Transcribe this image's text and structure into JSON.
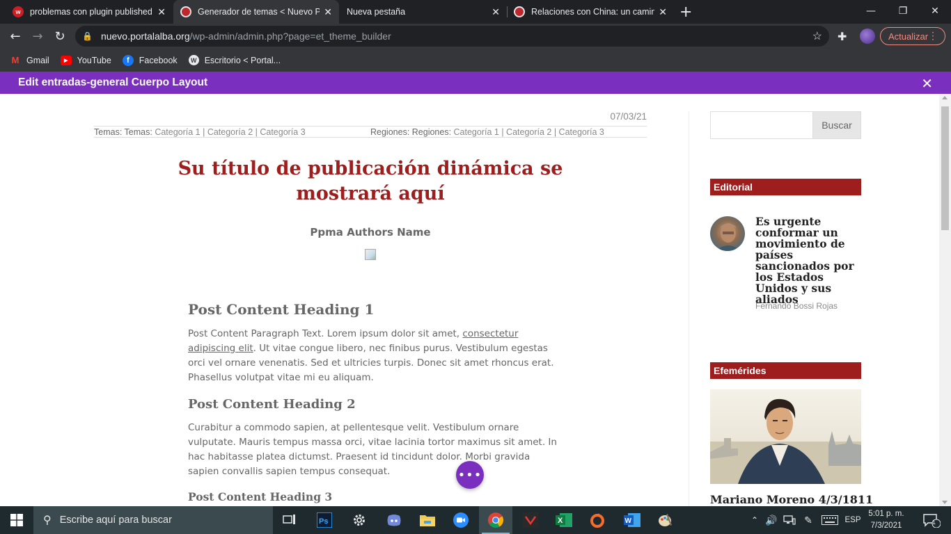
{
  "browser": {
    "tabs": [
      {
        "title": "problemas con plugin published",
        "active": false
      },
      {
        "title": "Generador de temas < Nuevo Po",
        "active": true
      },
      {
        "title": "Nueva pestaña",
        "active": false
      },
      {
        "title": "Relaciones con China: un camino",
        "active": false
      }
    ],
    "url_host": "nuevo.portalalba.org",
    "url_path": "/wp-admin/admin.php?page=et_theme_builder",
    "update_label": "Actualizar",
    "bookmarks": [
      {
        "label": "Gmail",
        "icon": "gmail-icon"
      },
      {
        "label": "YouTube",
        "icon": "youtube-icon"
      },
      {
        "label": "Facebook",
        "icon": "facebook-icon"
      },
      {
        "label": "Escritorio < Portal...",
        "icon": "wordpress-icon"
      }
    ]
  },
  "builder": {
    "title": "Edit entradas-general Cuerpo Layout"
  },
  "post": {
    "date": "07/03/21",
    "temas_label": "Temas: Temas:",
    "temas_cats": "Categoría 1 | Categoría 2 | Categoría 3",
    "regiones_label": "Regiones: Regiones:",
    "regiones_cats": "Categoría 1 | Categoría 2 | Categoría 3",
    "title": "Su título de publicación dinámica se mostrará aquí",
    "author": "Ppma Authors Name",
    "heading1": "Post Content Heading 1",
    "p1_before": "Post Content Paragraph Text. Lorem ipsum dolor sit amet, ",
    "p1_link": "consectetur adipiscing elit",
    "p1_after": ". Ut vitae congue libero, nec finibus purus. Vestibulum egestas orci vel ornare venenatis. Sed et ultricies turpis. Donec sit amet rhoncus erat. Phasellus volutpat vitae mi eu aliquam.",
    "heading2": "Post Content Heading 2",
    "p2": "Curabitur a commodo sapien, at pellentesque velit. Vestibulum ornare vulputate. Mauris tempus massa orci, vitae lacinia tortor maximus sit amet. In hac habitasse platea dictumst. Praesent id tincidunt dolor. Morbi gravida sapien convallis sapien tempus consequat.",
    "heading3": "Post Content Heading 3"
  },
  "sidebar": {
    "search_button": "Buscar",
    "editorial": {
      "heading": "Editorial",
      "title": "Es urgente conformar un movimiento de países sancionados por los Estados Unidos y sus aliados",
      "author": "Fernando Bossi Rojas"
    },
    "efemerides": {
      "heading": "Efemérides",
      "title": "Mariano Moreno 4/3/1811"
    }
  },
  "taskbar": {
    "search_placeholder": "Escribe aquí para buscar",
    "language": "ESP",
    "time": "5:01 p. m.",
    "date": "7/3/2021",
    "notification_count": "1"
  },
  "colors": {
    "builder_purple": "#7b2fbe",
    "title_red": "#9e1d1d",
    "browser_dark": "#202124"
  }
}
